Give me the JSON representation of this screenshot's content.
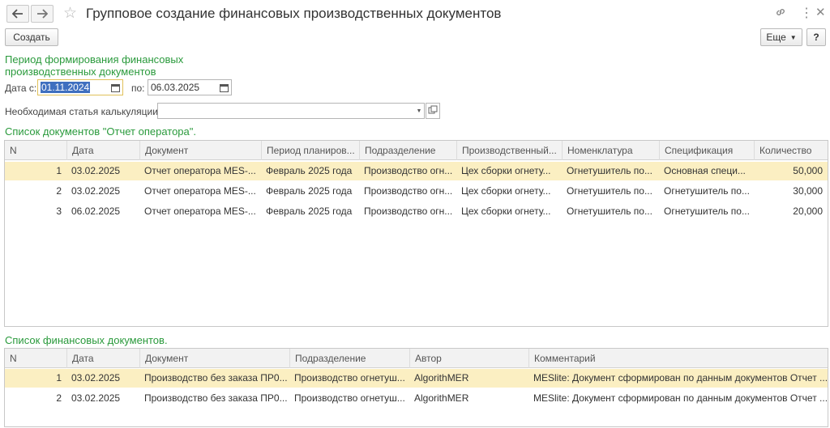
{
  "window": {
    "title": "Групповое создание финансовых производственных документов"
  },
  "toolbar": {
    "create_label": "Создать",
    "more_label": "Еще"
  },
  "period": {
    "heading_line1": "Период формирования финансовых",
    "heading_line2": "производственных документов",
    "date_from_label": "Дата с:",
    "date_from_value": "01.11.2024",
    "date_to_label": "по:",
    "date_to_value": "06.03.2025"
  },
  "calc": {
    "label": "Необходимая статья калькуляции:",
    "value": ""
  },
  "operator_reports": {
    "heading": "Список документов \"Отчет оператора\".",
    "columns": [
      "N",
      "Дата",
      "Документ",
      "Период планиров...",
      "Подразделение",
      "Производственный...",
      "Номенклатура",
      "Спецификация",
      "Количество"
    ],
    "rows": [
      [
        "1",
        "03.02.2025",
        "Отчет оператора MES-...",
        "Февраль 2025 года",
        "Производство огн...",
        "Цех сборки огнету...",
        "Огнетушитель по...",
        "Основная специ...",
        "50,000"
      ],
      [
        "2",
        "03.02.2025",
        "Отчет оператора MES-...",
        "Февраль 2025 года",
        "Производство огн...",
        "Цех сборки огнету...",
        "Огнетушитель по...",
        "Огнетушитель по...",
        "30,000"
      ],
      [
        "3",
        "06.02.2025",
        "Отчет оператора MES-...",
        "Февраль 2025 года",
        "Производство огн...",
        "Цех сборки огнету...",
        "Огнетушитель по...",
        "Огнетушитель по...",
        "20,000"
      ]
    ]
  },
  "financial_docs": {
    "heading": "Список финансовых документов.",
    "columns": [
      "N",
      "Дата",
      "Документ",
      "Подразделение",
      "Автор",
      "Комментарий"
    ],
    "rows": [
      [
        "1",
        "03.02.2025",
        "Производство без заказа ПР0...",
        "Производство огнетуш...",
        "AlgorithMER",
        "MESlite: Документ сформирован по данным документов Отчет ..."
      ],
      [
        "2",
        "03.02.2025",
        "Производство без заказа ПР0...",
        "Производство огнетуш...",
        "AlgorithMER",
        "MESlite: Документ сформирован по данным документов Отчет ..."
      ]
    ]
  },
  "colors": {
    "accent_green": "#2a9a3c",
    "row_highlight": "#fbefc2",
    "selection_blue": "#3f6fbf"
  },
  "icons": [
    "back-arrow-icon",
    "forward-arrow-icon",
    "star-icon",
    "link-icon",
    "more-vertical-icon",
    "close-icon",
    "calendar-icon",
    "dropdown-arrow-icon",
    "open-icon"
  ]
}
